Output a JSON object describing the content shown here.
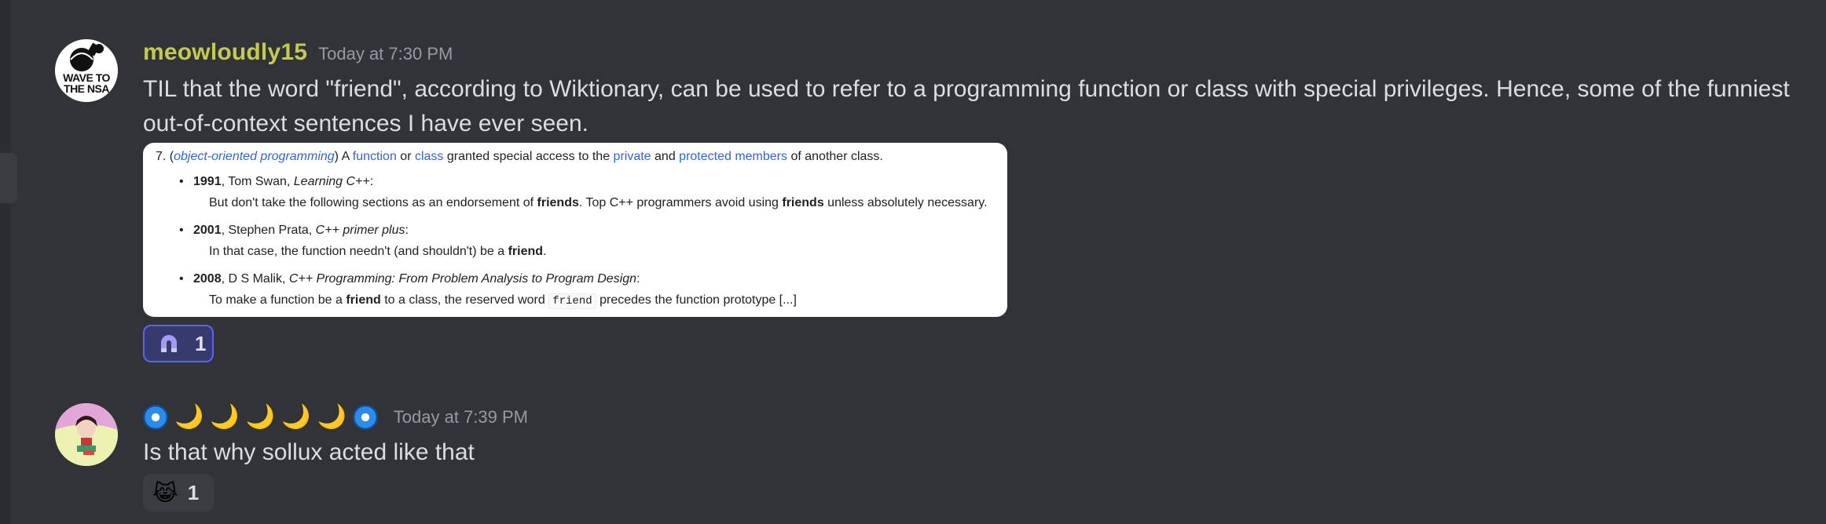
{
  "messages": [
    {
      "username": "meowloudly15",
      "timestamp": "Today at 7:30 PM",
      "avatar_text": "WAVE TO THE NSA",
      "text": "TIL that the word \"friend\", according to Wiktionary, can be used to refer to a programming function or class with special privileges. Hence, some of the funniest out-of-context sentences I have ever seen.",
      "embed": {
        "definition": {
          "number": "7.",
          "category": "object-oriented programming",
          "pre": " A ",
          "w1": "function",
          "mid1": " or ",
          "w2": "class",
          "mid2": " granted special access to the ",
          "w3": "private",
          "mid3": " and ",
          "w4": "protected members",
          "post": " of another class."
        },
        "quotes": [
          {
            "year": "1991",
            "author": ", Tom Swan, ",
            "title": "Learning C++",
            "colon": ":",
            "q_pre": "But don't take the following sections as an endorsement of ",
            "q_b1": "friends",
            "q_mid": ". Top C++ programmers avoid using ",
            "q_b2": "friends",
            "q_post": " unless absolutely necessary."
          },
          {
            "year": "2001",
            "author": ", Stephen Prata, ",
            "title": "C++ primer plus",
            "colon": ":",
            "q_pre": "In that case, the function needn't (and shouldn't) be a ",
            "q_b1": "friend",
            "q_post": "."
          },
          {
            "year": "2008",
            "author": ", D S Malik, ",
            "title": "C++ Programming: From Problem Analysis to Program Design",
            "colon": ":",
            "q_pre": "To make a function be a ",
            "q_b1": "friend",
            "q_mid": " to a class, the reserved word ",
            "q_code": "friend",
            "q_post": " precedes the function prototype [...]"
          }
        ]
      },
      "reaction": {
        "icon": "magnet-icon",
        "count": "1"
      }
    },
    {
      "username_emoji": [
        "swirl",
        "🌙",
        "🌙",
        "🌙",
        "🌙",
        "🌙",
        "swirl"
      ],
      "timestamp": "Today at 7:39 PM",
      "text": "Is that why sollux acted like that",
      "reaction": {
        "emoji": "😹",
        "count": "1"
      }
    }
  ],
  "colors": {
    "background": "#313338",
    "username1": "#c5c94f",
    "text": "#dbdee1",
    "timestamp": "#959ba3",
    "accent": "#5865f2"
  }
}
